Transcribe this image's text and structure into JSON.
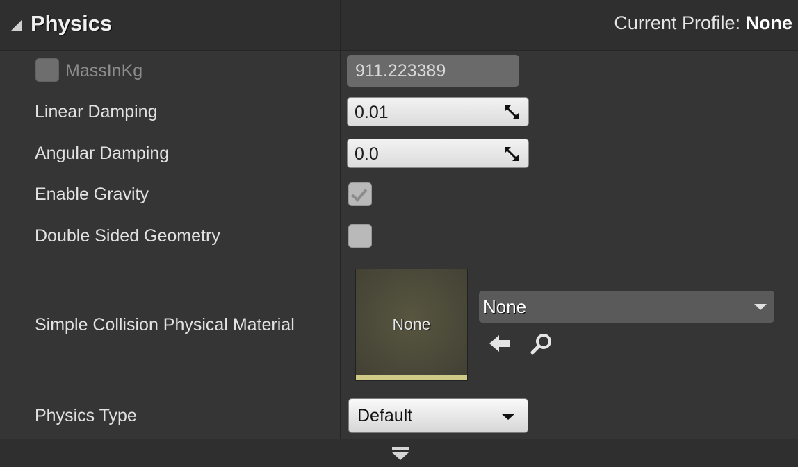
{
  "section": {
    "title": "Physics",
    "profile_label": "Current Profile:",
    "profile_value": "None"
  },
  "rows": {
    "mass": {
      "label": "MassInKg",
      "value": "911.223389",
      "override_enabled": false
    },
    "linear_damping": {
      "label": "Linear Damping",
      "value": "0.01"
    },
    "angular_damping": {
      "label": "Angular Damping",
      "value": "0.0"
    },
    "enable_gravity": {
      "label": "Enable Gravity",
      "checked": true
    },
    "double_sided": {
      "label": "Double Sided Geometry",
      "checked": false
    },
    "phys_material": {
      "label": "Simple Collision Physical Material",
      "thumbnail_text": "None",
      "selected": "None"
    },
    "physics_type": {
      "label": "Physics Type",
      "selected": "Default"
    }
  },
  "icons": {
    "collapse": "collapse-triangle-icon",
    "resize": "resize-arrows-icon",
    "use_selected": "arrow-left-icon",
    "browse": "search-icon",
    "combo": "chevron-down-icon",
    "expand_more": "double-chevron-down-icon"
  },
  "colors": {
    "panel_bg": "#353535",
    "header_bg": "#2f2f2f",
    "thumbnail_bar": "#cfca85"
  }
}
